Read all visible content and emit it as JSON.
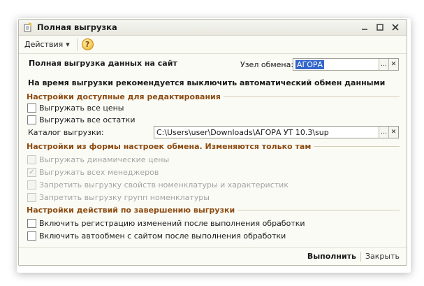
{
  "window": {
    "title": "Полная выгрузка"
  },
  "toolbar": {
    "actions_label": "Действия",
    "help_glyph": "?"
  },
  "header": {
    "title": "Полная выгрузка данных на сайт",
    "exchange_node_label": "Узел обмена:",
    "exchange_node_value": "АГОРА",
    "recommendation": "На время выгрузки рекомендуется выключить автоматический обмен данными"
  },
  "section_editable": {
    "title": "Настройки доступные для редактирования",
    "items": [
      {
        "label": "Выгружать все цены",
        "checked": false
      },
      {
        "label": "Выгружать все остатки",
        "checked": false
      }
    ],
    "catalog_label": "Каталог выгрузки:",
    "catalog_value": "C:\\Users\\user\\Downloads\\АГОРА УТ 10.3\\sup"
  },
  "section_from_settings": {
    "title": "Настройки из формы настроек обмена. Изменяются только там",
    "items": [
      {
        "label": "Выгружать динамические цены",
        "checked": false
      },
      {
        "label": "Выгружать всех менеджеров",
        "checked": true
      },
      {
        "label": "Запретить выгрузку свойств номенклатуры и характеристик",
        "checked": false
      },
      {
        "label": "Запретить выгрузку групп номенклатуры",
        "checked": false
      }
    ]
  },
  "section_after": {
    "title": "Настройки действий по завершению выгрузки",
    "items": [
      {
        "label": "Включить регистрацию изменений после выполнения обработки",
        "checked": false
      },
      {
        "label": "Включить автообмен с сайтом после выполнения обработки",
        "checked": false
      }
    ]
  },
  "footer": {
    "run_label": "Выполнить",
    "close_label": "Закрыть"
  },
  "colors": {
    "section_title": "#8b4b10",
    "selection": "#3366cc"
  }
}
